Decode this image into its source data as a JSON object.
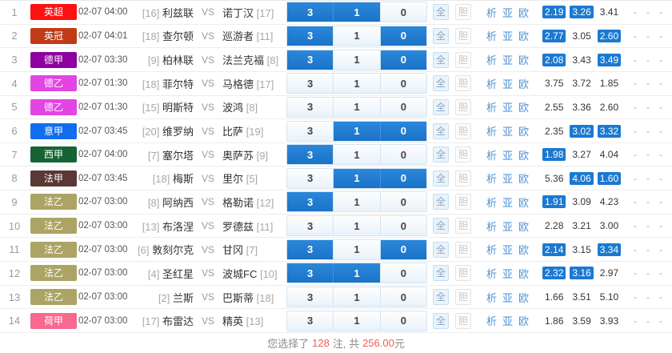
{
  "table": {
    "vs_label": "VS",
    "pick_keys": [
      "win",
      "draw",
      "lose"
    ],
    "link_keys": [
      "analysis",
      "asia",
      "europe"
    ],
    "actions": {
      "all": "全",
      "dan": "胆"
    },
    "links": [
      "析",
      "亚",
      "欧"
    ],
    "extra": [
      "-",
      "-",
      "-"
    ],
    "selected_pick_color": "#1b79d1",
    "rows": [
      {
        "num": "1",
        "league": {
          "label": "英超",
          "color": "#fe1111"
        },
        "time": "02-07 04:00",
        "home": {
          "rank": "[16]",
          "name": "利兹联"
        },
        "away": {
          "name": "诺丁汉",
          "rank": "[17]"
        },
        "picks": [
          {
            "label": "3",
            "selected": true
          },
          {
            "label": "1",
            "selected": true
          },
          {
            "label": "0",
            "selected": false
          }
        ],
        "odds": [
          {
            "value": "2.19",
            "selected": true
          },
          {
            "value": "3.26",
            "selected": true
          },
          {
            "value": "3.41",
            "selected": false
          }
        ]
      },
      {
        "num": "2",
        "league": {
          "label": "英冠",
          "color": "#c13a17"
        },
        "time": "02-07 04:01",
        "home": {
          "rank": "[18]",
          "name": "查尔顿"
        },
        "away": {
          "name": "巡游者",
          "rank": "[11]"
        },
        "picks": [
          {
            "label": "3",
            "selected": true
          },
          {
            "label": "1",
            "selected": false
          },
          {
            "label": "0",
            "selected": true
          }
        ],
        "odds": [
          {
            "value": "2.77",
            "selected": true
          },
          {
            "value": "3.05",
            "selected": false
          },
          {
            "value": "2.60",
            "selected": true
          }
        ]
      },
      {
        "num": "3",
        "league": {
          "label": "德甲",
          "color": "#8d01a0"
        },
        "time": "02-07 03:30",
        "home": {
          "rank": "[9]",
          "name": "柏林联"
        },
        "away": {
          "name": "法兰克福",
          "rank": "[8]"
        },
        "picks": [
          {
            "label": "3",
            "selected": true
          },
          {
            "label": "1",
            "selected": false
          },
          {
            "label": "0",
            "selected": true
          }
        ],
        "odds": [
          {
            "value": "2.08",
            "selected": true
          },
          {
            "value": "3.43",
            "selected": false
          },
          {
            "value": "3.49",
            "selected": true
          }
        ]
      },
      {
        "num": "4",
        "league": {
          "label": "德乙",
          "color": "#e345e3"
        },
        "time": "02-07 01:30",
        "home": {
          "rank": "[18]",
          "name": "菲尔特"
        },
        "away": {
          "name": "马格德",
          "rank": "[17]"
        },
        "picks": [
          {
            "label": "3",
            "selected": false
          },
          {
            "label": "1",
            "selected": false
          },
          {
            "label": "0",
            "selected": false
          }
        ],
        "odds": [
          {
            "value": "3.75",
            "selected": false
          },
          {
            "value": "3.72",
            "selected": false
          },
          {
            "value": "1.85",
            "selected": false
          }
        ]
      },
      {
        "num": "5",
        "league": {
          "label": "德乙",
          "color": "#e345e3"
        },
        "time": "02-07 01:30",
        "home": {
          "rank": "[15]",
          "name": "明斯特"
        },
        "away": {
          "name": "波鸿",
          "rank": "[8]"
        },
        "picks": [
          {
            "label": "3",
            "selected": false
          },
          {
            "label": "1",
            "selected": false
          },
          {
            "label": "0",
            "selected": false
          }
        ],
        "odds": [
          {
            "value": "2.55",
            "selected": false
          },
          {
            "value": "3.36",
            "selected": false
          },
          {
            "value": "2.60",
            "selected": false
          }
        ]
      },
      {
        "num": "6",
        "league": {
          "label": "意甲",
          "color": "#106eee"
        },
        "time": "02-07 03:45",
        "home": {
          "rank": "[20]",
          "name": "维罗纳"
        },
        "away": {
          "name": "比萨",
          "rank": "[19]"
        },
        "picks": [
          {
            "label": "3",
            "selected": false
          },
          {
            "label": "1",
            "selected": true
          },
          {
            "label": "0",
            "selected": true
          }
        ],
        "odds": [
          {
            "value": "2.35",
            "selected": false
          },
          {
            "value": "3.02",
            "selected": true
          },
          {
            "value": "3.32",
            "selected": true
          }
        ]
      },
      {
        "num": "7",
        "league": {
          "label": "西甲",
          "color": "#166434"
        },
        "time": "02-07 04:00",
        "home": {
          "rank": "[7]",
          "name": "塞尔塔"
        },
        "away": {
          "name": "奥萨苏",
          "rank": "[9]"
        },
        "picks": [
          {
            "label": "3",
            "selected": true
          },
          {
            "label": "1",
            "selected": false
          },
          {
            "label": "0",
            "selected": false
          }
        ],
        "odds": [
          {
            "value": "1.98",
            "selected": true
          },
          {
            "value": "3.27",
            "selected": false
          },
          {
            "value": "4.04",
            "selected": false
          }
        ]
      },
      {
        "num": "8",
        "league": {
          "label": "法甲",
          "color": "#5b3735"
        },
        "time": "02-07 03:45",
        "home": {
          "rank": "[18]",
          "name": "梅斯"
        },
        "away": {
          "name": "里尔",
          "rank": "[5]"
        },
        "picks": [
          {
            "label": "3",
            "selected": false
          },
          {
            "label": "1",
            "selected": true
          },
          {
            "label": "0",
            "selected": true
          }
        ],
        "odds": [
          {
            "value": "5.36",
            "selected": false
          },
          {
            "value": "4.06",
            "selected": true
          },
          {
            "value": "1.60",
            "selected": true
          }
        ]
      },
      {
        "num": "9",
        "league": {
          "label": "法乙",
          "color": "#aca464"
        },
        "time": "02-07 03:00",
        "home": {
          "rank": "[8]",
          "name": "阿纳西"
        },
        "away": {
          "name": "格勒诺",
          "rank": "[12]"
        },
        "picks": [
          {
            "label": "3",
            "selected": true
          },
          {
            "label": "1",
            "selected": false
          },
          {
            "label": "0",
            "selected": false
          }
        ],
        "odds": [
          {
            "value": "1.91",
            "selected": true
          },
          {
            "value": "3.09",
            "selected": false
          },
          {
            "value": "4.23",
            "selected": false
          }
        ]
      },
      {
        "num": "10",
        "league": {
          "label": "法乙",
          "color": "#aca464"
        },
        "time": "02-07 03:00",
        "home": {
          "rank": "[13]",
          "name": "布洛涅"
        },
        "away": {
          "name": "罗德兹",
          "rank": "[11]"
        },
        "picks": [
          {
            "label": "3",
            "selected": false
          },
          {
            "label": "1",
            "selected": false
          },
          {
            "label": "0",
            "selected": false
          }
        ],
        "odds": [
          {
            "value": "2.28",
            "selected": false
          },
          {
            "value": "3.21",
            "selected": false
          },
          {
            "value": "3.00",
            "selected": false
          }
        ]
      },
      {
        "num": "11",
        "league": {
          "label": "法乙",
          "color": "#aca464"
        },
        "time": "02-07 03:00",
        "home": {
          "rank": "[6]",
          "name": "敦刻尔克"
        },
        "away": {
          "name": "甘冈",
          "rank": "[7]"
        },
        "picks": [
          {
            "label": "3",
            "selected": true
          },
          {
            "label": "1",
            "selected": false
          },
          {
            "label": "0",
            "selected": true
          }
        ],
        "odds": [
          {
            "value": "2.14",
            "selected": true
          },
          {
            "value": "3.15",
            "selected": false
          },
          {
            "value": "3.34",
            "selected": true
          }
        ]
      },
      {
        "num": "12",
        "league": {
          "label": "法乙",
          "color": "#aca464"
        },
        "time": "02-07 03:00",
        "home": {
          "rank": "[4]",
          "name": "圣红星"
        },
        "away": {
          "name": "波城FC",
          "rank": "[10]"
        },
        "picks": [
          {
            "label": "3",
            "selected": true
          },
          {
            "label": "1",
            "selected": true
          },
          {
            "label": "0",
            "selected": false
          }
        ],
        "odds": [
          {
            "value": "2.32",
            "selected": true
          },
          {
            "value": "3.16",
            "selected": true
          },
          {
            "value": "2.97",
            "selected": false
          }
        ]
      },
      {
        "num": "13",
        "league": {
          "label": "法乙",
          "color": "#aca464"
        },
        "time": "02-07 03:00",
        "home": {
          "rank": "[2]",
          "name": "兰斯"
        },
        "away": {
          "name": "巴斯蒂",
          "rank": "[18]"
        },
        "picks": [
          {
            "label": "3",
            "selected": false
          },
          {
            "label": "1",
            "selected": false
          },
          {
            "label": "0",
            "selected": false
          }
        ],
        "odds": [
          {
            "value": "1.66",
            "selected": false
          },
          {
            "value": "3.51",
            "selected": false
          },
          {
            "value": "5.10",
            "selected": false
          }
        ]
      },
      {
        "num": "14",
        "league": {
          "label": "荷甲",
          "color": "#f9688f"
        },
        "time": "02-07 03:00",
        "home": {
          "rank": "[17]",
          "name": "布雷达"
        },
        "away": {
          "name": "精英",
          "rank": "[13]"
        },
        "picks": [
          {
            "label": "3",
            "selected": false
          },
          {
            "label": "1",
            "selected": false
          },
          {
            "label": "0",
            "selected": false
          }
        ],
        "odds": [
          {
            "value": "1.86",
            "selected": false
          },
          {
            "value": "3.59",
            "selected": false
          },
          {
            "value": "3.93",
            "selected": false
          }
        ]
      }
    ]
  },
  "footer": {
    "prefix": "您选择了",
    "bet_count": "128",
    "middle": "注, 共",
    "amount": "256.00",
    "suffix": "元",
    "highlight_color": "#f25b50"
  }
}
